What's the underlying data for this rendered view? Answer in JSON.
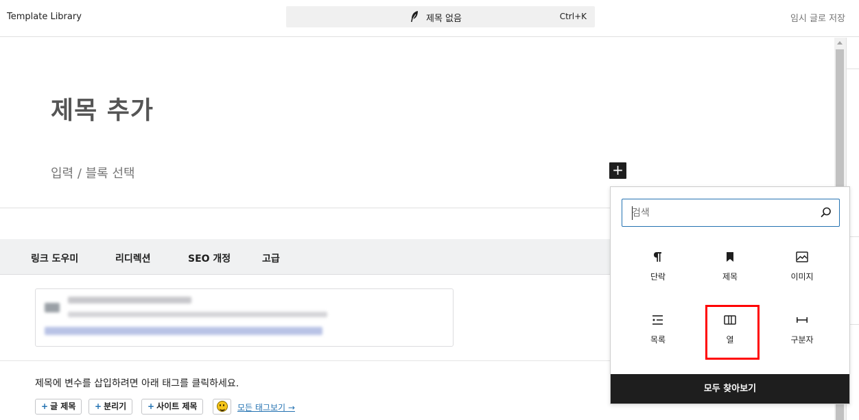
{
  "header": {
    "app_title": "Template Library",
    "command_bar": {
      "title": "제목 없음",
      "shortcut": "Ctrl+K"
    },
    "save_draft_label": "임시 글로 저장"
  },
  "editor": {
    "title_placeholder": "제목 추가",
    "block_placeholder": "입력 / 블록 선택",
    "inserter_toggle_symbol": "+"
  },
  "meta_box": {
    "tabs": [
      "링크 도우미",
      "리디렉션",
      "SEO 개정",
      "고급"
    ],
    "tag_hint": "제목에 변수를 삽입하려면 아래 태그를 클릭하세요.",
    "tag_buttons": [
      "글 제목",
      "분리기",
      "사이트 제목"
    ],
    "all_tags_link": "모든 태그보기 →"
  },
  "inserter": {
    "search_placeholder": "검색",
    "blocks": [
      {
        "label": "단락",
        "icon": "paragraph-icon"
      },
      {
        "label": "제목",
        "icon": "bookmark-icon"
      },
      {
        "label": "이미지",
        "icon": "image-icon"
      },
      {
        "label": "목록",
        "icon": "list-icon"
      },
      {
        "label": "열",
        "icon": "columns-icon"
      },
      {
        "label": "구분자",
        "icon": "separator-icon"
      }
    ],
    "browse_all_label": "모두 찾아보기"
  },
  "colors": {
    "accent": "#2271b1",
    "highlight": "#ff0000",
    "dark": "#1e1e1e"
  }
}
